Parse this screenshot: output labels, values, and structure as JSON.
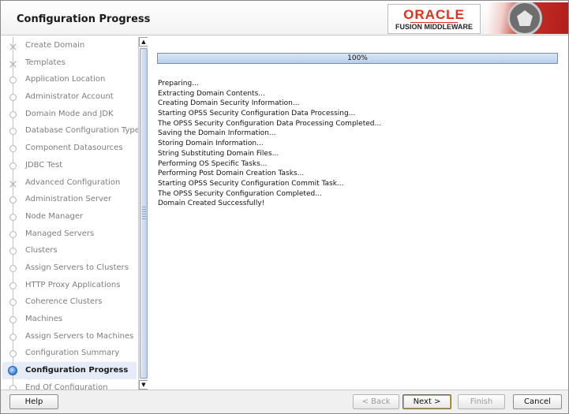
{
  "header": {
    "title": "Configuration Progress",
    "logo_brand": "ORACLE",
    "logo_product": "FUSION MIDDLEWARE"
  },
  "sidebar": {
    "items": [
      {
        "label": "Create Domain",
        "node": "branch"
      },
      {
        "label": "Templates",
        "node": "branch"
      },
      {
        "label": "Application Location",
        "node": "circle"
      },
      {
        "label": "Administrator Account",
        "node": "circle"
      },
      {
        "label": "Domain Mode and JDK",
        "node": "circle"
      },
      {
        "label": "Database Configuration Type",
        "node": "circle"
      },
      {
        "label": "Component Datasources",
        "node": "circle"
      },
      {
        "label": "JDBC Test",
        "node": "circle"
      },
      {
        "label": "Advanced Configuration",
        "node": "branch"
      },
      {
        "label": "Administration Server",
        "node": "circle"
      },
      {
        "label": "Node Manager",
        "node": "circle"
      },
      {
        "label": "Managed Servers",
        "node": "circle"
      },
      {
        "label": "Clusters",
        "node": "circle"
      },
      {
        "label": "Assign Servers to Clusters",
        "node": "circle"
      },
      {
        "label": "HTTP Proxy Applications",
        "node": "circle"
      },
      {
        "label": "Coherence Clusters",
        "node": "circle"
      },
      {
        "label": "Machines",
        "node": "circle"
      },
      {
        "label": "Assign Servers to Machines",
        "node": "circle"
      },
      {
        "label": "Configuration Summary",
        "node": "circle"
      },
      {
        "label": "Configuration Progress",
        "node": "current",
        "active": true
      },
      {
        "label": "End Of Configuration",
        "node": "circle"
      }
    ]
  },
  "progress": {
    "label": "100%",
    "value": 1.0
  },
  "log": [
    "Preparing...",
    "Extracting Domain Contents...",
    "Creating Domain Security Information...",
    "Starting OPSS Security Configuration Data Processing...",
    "The OPSS Security Configuration Data Processing Completed...",
    "Saving the Domain Information...",
    "Storing Domain Information...",
    "String Substituting Domain Files...",
    "Performing OS Specific Tasks...",
    "Performing Post Domain Creation Tasks...",
    "Starting OPSS Security Configuration Commit Task...",
    "The OPSS Security Configuration Completed...",
    "Domain Created Successfully!"
  ],
  "footer": {
    "help": "Help",
    "back": "< Back",
    "next": "Next >",
    "finish": "Finish",
    "cancel": "Cancel"
  }
}
